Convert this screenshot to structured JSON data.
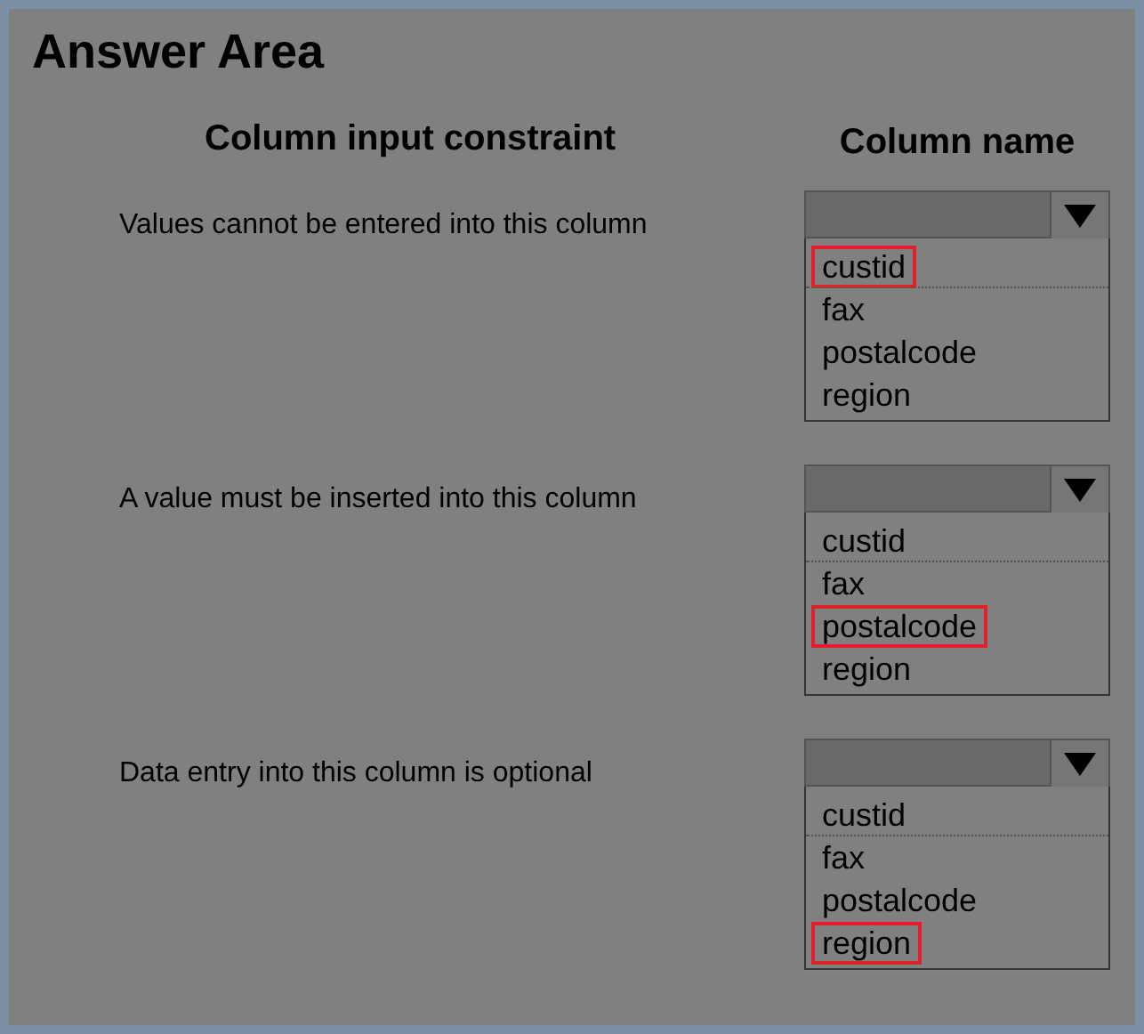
{
  "title": "Answer Area",
  "headers": {
    "constraint": "Column input constraint",
    "column": "Column name"
  },
  "rows": [
    {
      "constraint": "Values cannot be entered into this column",
      "options": [
        {
          "label": "custid",
          "selected": true
        },
        {
          "label": "fax",
          "selected": false
        },
        {
          "label": "postalcode",
          "selected": false
        },
        {
          "label": "region",
          "selected": false
        }
      ]
    },
    {
      "constraint": "A value must be inserted into this column",
      "options": [
        {
          "label": "custid",
          "selected": false
        },
        {
          "label": "fax",
          "selected": false
        },
        {
          "label": "postalcode",
          "selected": true
        },
        {
          "label": "region",
          "selected": false
        }
      ]
    },
    {
      "constraint": "Data entry into this column is optional",
      "options": [
        {
          "label": "custid",
          "selected": false
        },
        {
          "label": "fax",
          "selected": false
        },
        {
          "label": "postalcode",
          "selected": false
        },
        {
          "label": "region",
          "selected": true
        }
      ]
    }
  ]
}
